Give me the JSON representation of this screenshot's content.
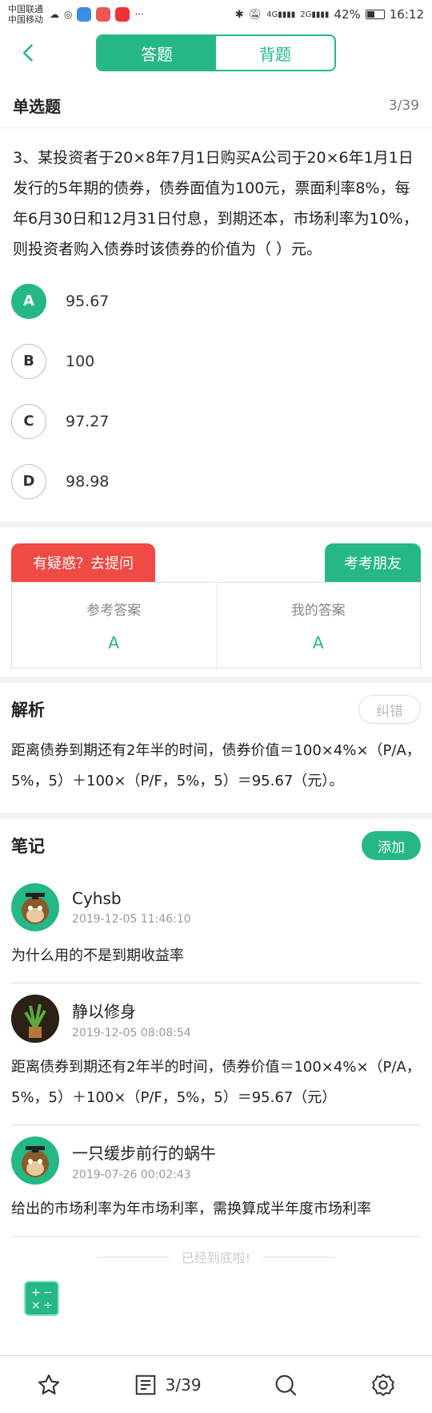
{
  "status_bar": {
    "carrier1": "中国联通",
    "carrier2": "中国移动",
    "signal_a": "4G",
    "signal_b": "2G",
    "battery": "42%",
    "time": "16:12",
    "more": "···"
  },
  "nav": {
    "back_icon": "chevron-left-icon",
    "tab_answer": "答题",
    "tab_memorize": "背题"
  },
  "question_header": {
    "type": "单选题",
    "count": "3/39"
  },
  "question": {
    "text": "3、某投资者于20×8年7月1日购买A公司于20×6年1月1日发行的5年期的债券，债券面值为100元，票面利率8%，每年6月30日和12月31日付息，到期还本，市场利率为10%，则投资者购入债券时该债券的价值为（    ）元。"
  },
  "options": [
    {
      "letter": "A",
      "text": "95.67",
      "correct": true
    },
    {
      "letter": "B",
      "text": "100",
      "correct": false
    },
    {
      "letter": "C",
      "text": "97.27",
      "correct": false
    },
    {
      "letter": "D",
      "text": "98.98",
      "correct": false
    }
  ],
  "answer_panel": {
    "ask_button": "有疑惑？去提问",
    "friend_button": "考考朋友",
    "ref_label": "参考答案",
    "ref_value": "A",
    "my_label": "我的答案",
    "my_value": "A"
  },
  "analysis": {
    "title": "解析",
    "correct_button": "纠错",
    "text": "距离债券到期还有2年半的时间，债券价值＝100×4%×（P/A，5%，5）＋100×（P/F，5%，5）＝95.67（元）。"
  },
  "notes": {
    "title": "笔记",
    "add_button": "添加",
    "items": [
      {
        "user": "Cyhsb",
        "time": "2019-12-05 11:46:10",
        "text": "为什么用的不是到期收益率"
      },
      {
        "user": "静以修身",
        "time": "2019-12-05 08:08:54",
        "text": "距离债券到期还有2年半的时间，债券价值＝100×4%×（P/A，5%，5）＋100×（P/F，5%，5）＝95.67（元）"
      },
      {
        "user": "一只缓步前行的蜗牛",
        "time": "2019-07-26 00:02:43",
        "text": "给出的市场利率为年市场利率，需换算成半年度市场利率"
      }
    ]
  },
  "footer_hint": "已经到底啦!",
  "tabbar": {
    "star_icon": "star-icon",
    "list_icon": "list-icon",
    "progress": "3/39",
    "search_icon": "search-icon",
    "settings_icon": "gear-icon"
  },
  "colors": {
    "accent": "#25b886",
    "ask": "#ef4a43"
  }
}
